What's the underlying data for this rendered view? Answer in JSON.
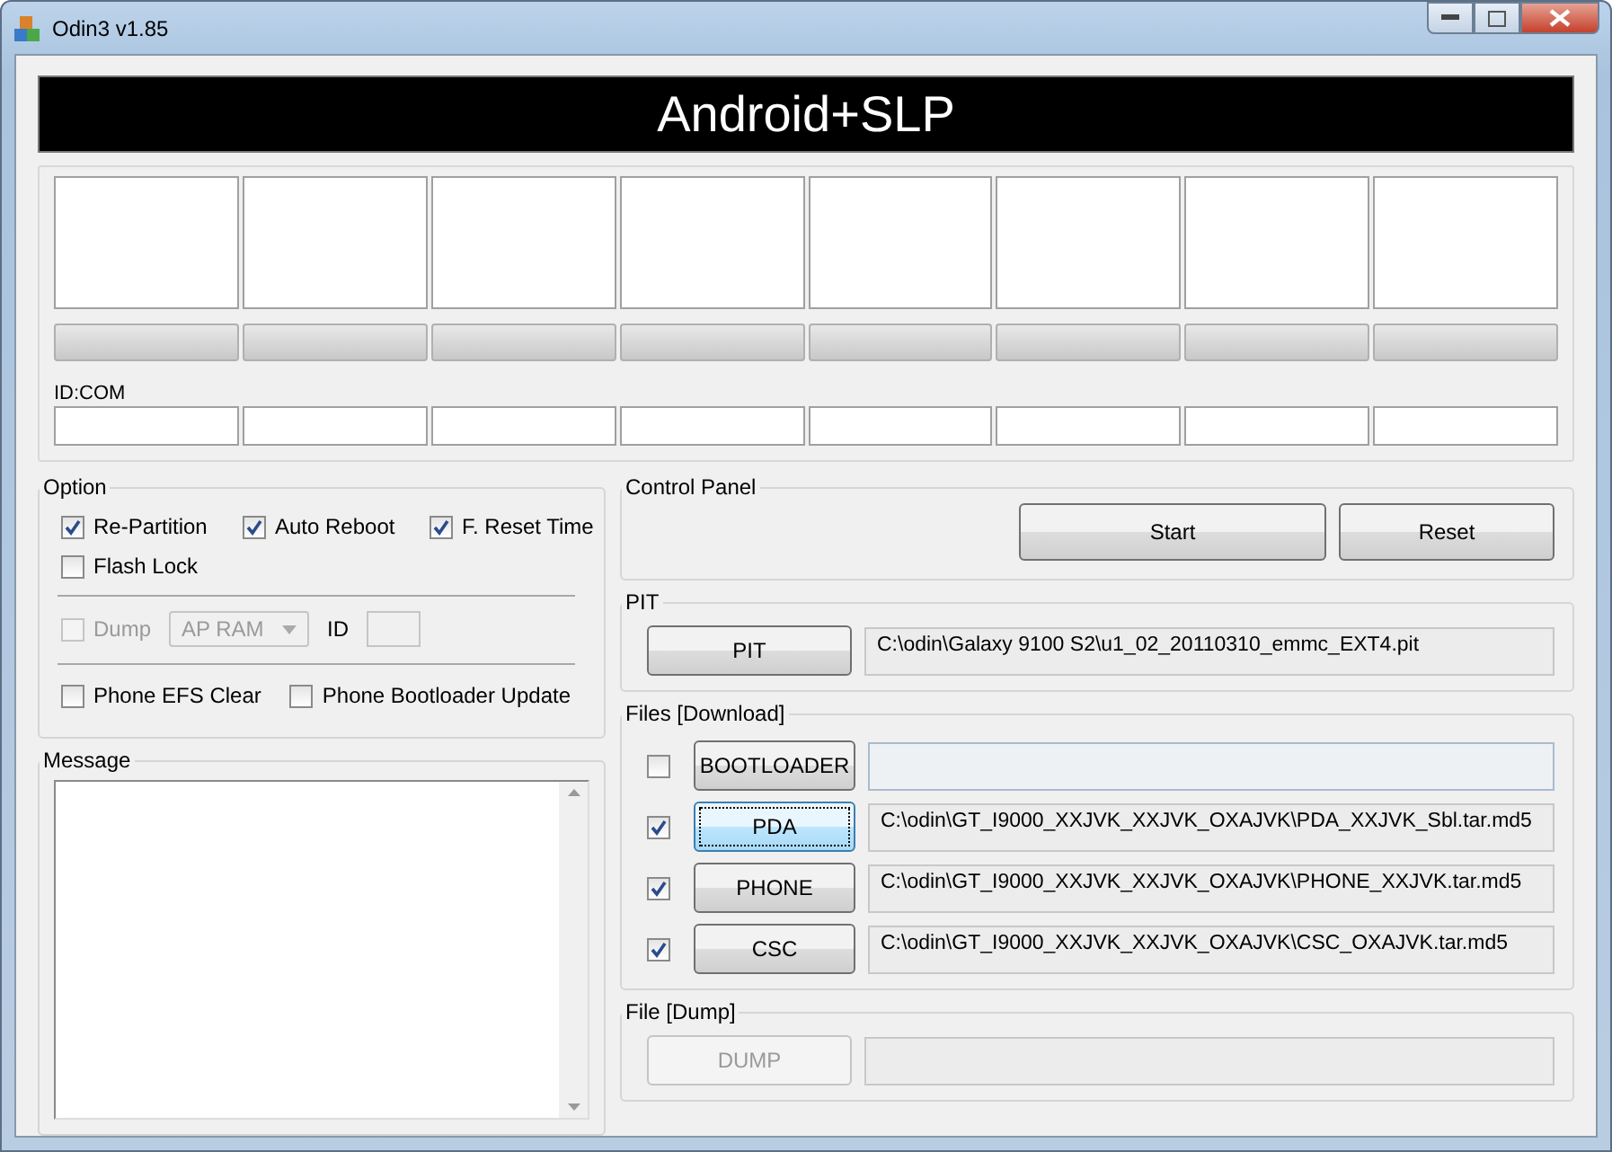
{
  "window": {
    "title": "Odin3 v1.85"
  },
  "banner": {
    "title": "Android+SLP"
  },
  "ports": {
    "progress_bars": [
      {
        "level": 0
      },
      {
        "level": 0
      },
      {
        "level": 0
      },
      {
        "level": 0
      },
      {
        "level": 0
      },
      {
        "level": 0
      },
      {
        "level": 0
      },
      {
        "level": 0
      }
    ],
    "id_com_label": "ID:COM"
  },
  "option_group": {
    "title": "Option",
    "checkboxes": [
      {
        "label": "Re-Partition",
        "checked": true
      },
      {
        "label": "Auto Reboot",
        "checked": true
      },
      {
        "label": "F. Reset Time",
        "checked": true
      },
      {
        "label": "Flash Lock",
        "checked": false
      }
    ],
    "dump": {
      "label": "Dump",
      "checked": false,
      "disabled": true,
      "dropdown": {
        "value": "AP RAM",
        "disabled": true
      },
      "id_label": "ID"
    },
    "phone_checkboxes": [
      {
        "label": "Phone EFS Clear",
        "checked": false
      },
      {
        "label": "Phone Bootloader Update",
        "checked": false
      }
    ]
  },
  "message_group": {
    "title": "Message"
  },
  "control_panel": {
    "title": "Control Panel",
    "buttons": [
      "Start",
      "Reset"
    ]
  },
  "pit_group": {
    "title": "PIT",
    "button": "PIT",
    "path": "C:\\odin\\Galaxy 9100 S2\\u1_02_20110310_emmc_EXT4.pit"
  },
  "files_group": {
    "title": "Files [Download]",
    "rows": [
      {
        "checked": false,
        "button": "BOOTLOADER",
        "focused": false
      },
      {
        "checked": true,
        "button": "PDA",
        "focused": true,
        "path": "C:\\odin\\GT_I9000_XXJVK_XXJVK_OXAJVK\\PDA_XXJVK_Sbl.tar.md5"
      },
      {
        "checked": true,
        "button": "PHONE",
        "focused": false,
        "path": "C:\\odin\\GT_I9000_XXJVK_XXJVK_OXAJVK\\PHONE_XXJVK.tar.md5"
      },
      {
        "checked": true,
        "button": "CSC",
        "focused": false,
        "path": "C:\\odin\\GT_I9000_XXJVK_XXJVK_OXAJVK\\CSC_OXAJVK.tar.md5"
      }
    ]
  },
  "dump_group": {
    "title": "File [Dump]",
    "button": "DUMP",
    "disabled": true
  }
}
